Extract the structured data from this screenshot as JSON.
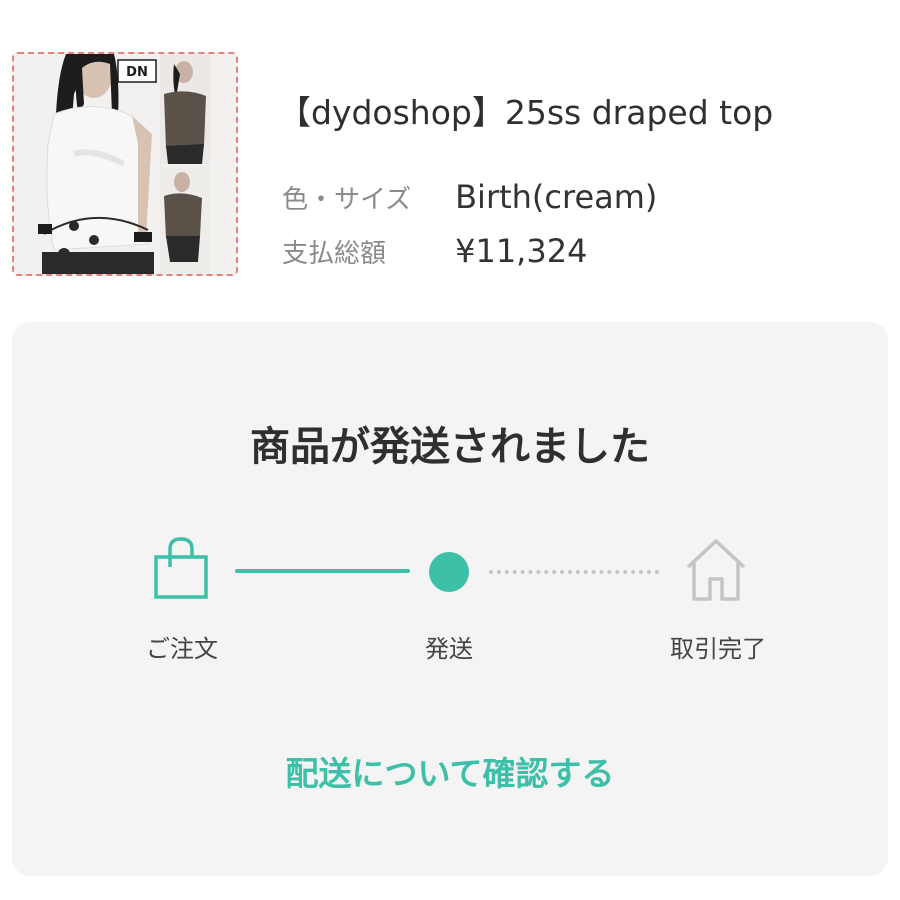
{
  "product": {
    "title": "【dydoshop】25ss draped top",
    "color_size_label": "色・サイズ",
    "color_size_value": "Birth(cream)",
    "total_label": "支払総額",
    "total_value": "¥11,324",
    "image_logo_text": "DN"
  },
  "status": {
    "heading": "商品が発送されました",
    "steps": [
      {
        "label": "ご注文",
        "icon": "shopping-bag-icon",
        "state": "complete"
      },
      {
        "label": "発送",
        "icon": "progress-dot",
        "state": "current"
      },
      {
        "label": "取引完了",
        "icon": "home-icon",
        "state": "pending"
      }
    ],
    "confirm_link": "配送について確認する"
  },
  "colors": {
    "accent": "#3dbfa8",
    "pending": "#c4c4c4",
    "card_bg": "#f4f4f4",
    "text_primary": "#2f2f2f",
    "text_muted": "#8a8a8a"
  }
}
